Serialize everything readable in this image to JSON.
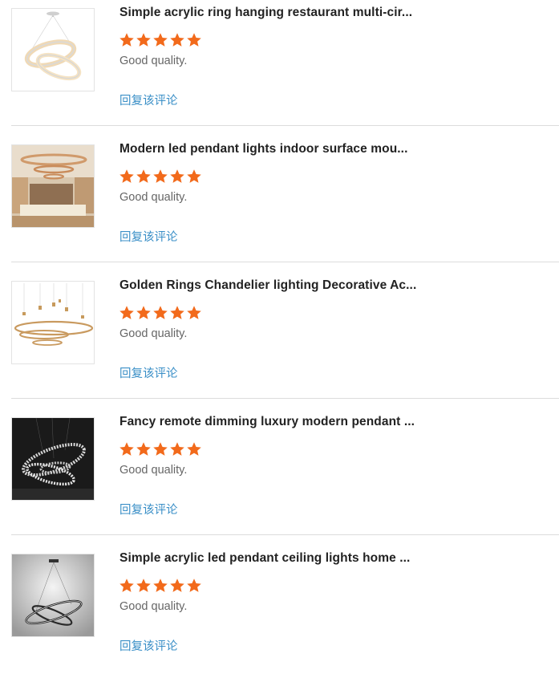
{
  "reviews": [
    {
      "title": "Simple acrylic ring hanging restaurant multi-cir...",
      "rating": 5,
      "comment": "Good quality.",
      "reply_label": "回复该评论",
      "thumbnail_icon": "ring-pendant-light-image"
    },
    {
      "title": "Modern led pendant lights indoor surface mou...",
      "rating": 5,
      "comment": "Good quality.",
      "reply_label": "回复该评论",
      "thumbnail_icon": "living-room-pendant-image"
    },
    {
      "title": "Golden Rings Chandelier lighting Decorative Ac...",
      "rating": 5,
      "comment": "Good quality.",
      "reply_label": "回复该评论",
      "thumbnail_icon": "gold-rings-chandelier-image"
    },
    {
      "title": "Fancy remote dimming luxury modern pendant ...",
      "rating": 5,
      "comment": "Good quality.",
      "reply_label": "回复该评论",
      "thumbnail_icon": "crystal-rings-pendant-image"
    },
    {
      "title": "Simple acrylic led pendant ceiling lights home ...",
      "rating": 5,
      "comment": "Good quality.",
      "reply_label": "回复该评论",
      "thumbnail_icon": "black-rings-pendant-image"
    }
  ],
  "colors": {
    "star": "#f26a1b",
    "reply_link": "#3a8fc7",
    "title": "#222222",
    "comment": "#666666"
  }
}
